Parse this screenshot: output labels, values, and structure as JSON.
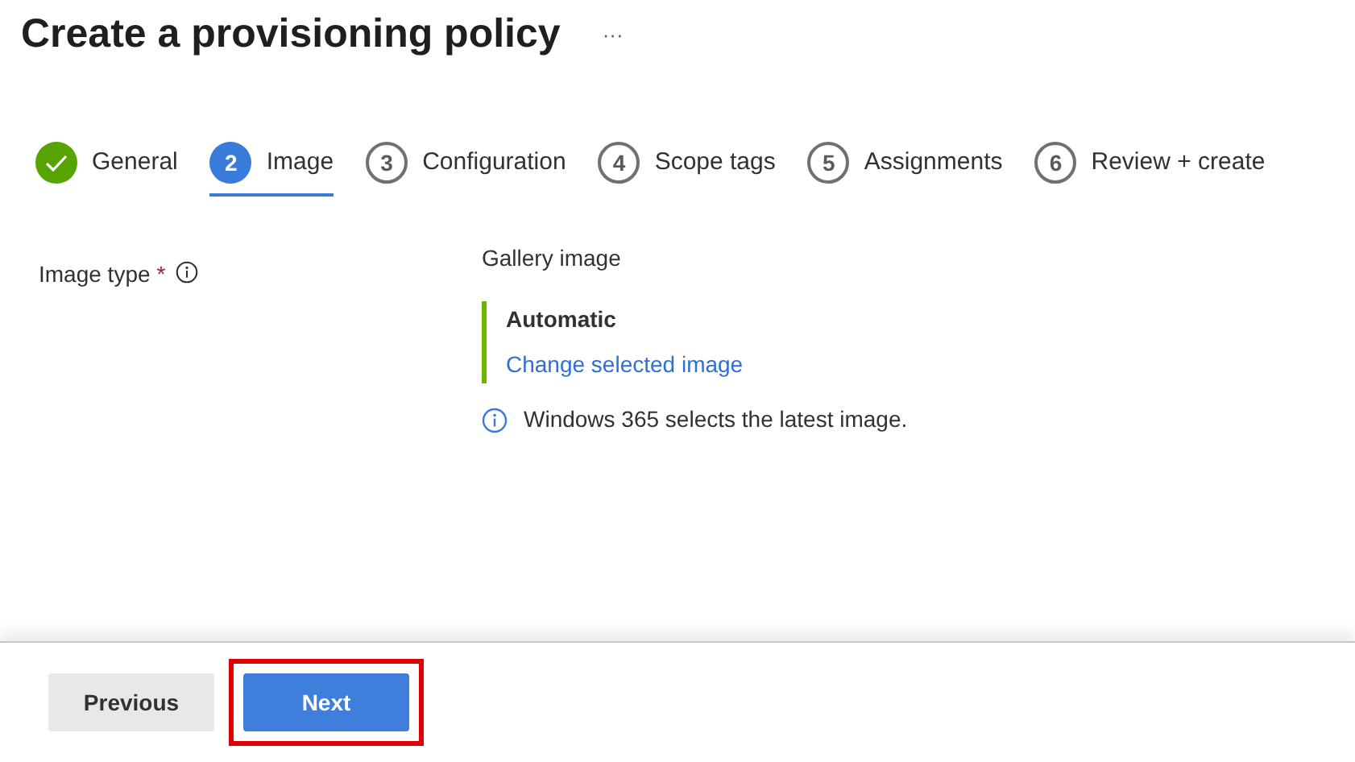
{
  "title": "Create a provisioning policy",
  "more": "···",
  "steps": [
    {
      "kind": "done",
      "label": "General",
      "selected": false
    },
    {
      "kind": "numbered",
      "number": "2",
      "label": "Image",
      "selected": true
    },
    {
      "kind": "numbered",
      "number": "3",
      "label": "Configuration",
      "selected": false
    },
    {
      "kind": "numbered",
      "number": "4",
      "label": "Scope tags",
      "selected": false
    },
    {
      "kind": "numbered",
      "number": "5",
      "label": "Assignments",
      "selected": false
    },
    {
      "kind": "numbered",
      "number": "6",
      "label": "Review + create",
      "selected": false
    }
  ],
  "field": {
    "label": "Image type",
    "required_mark": "*",
    "category": "Gallery image",
    "choice": "Automatic",
    "link": "Change selected image",
    "note": "Windows 365 selects the latest image."
  },
  "footer": [
    {
      "kind": "secondary",
      "label": "Previous",
      "highlighted": false
    },
    {
      "kind": "primary",
      "label": "Next",
      "highlighted": true
    }
  ]
}
